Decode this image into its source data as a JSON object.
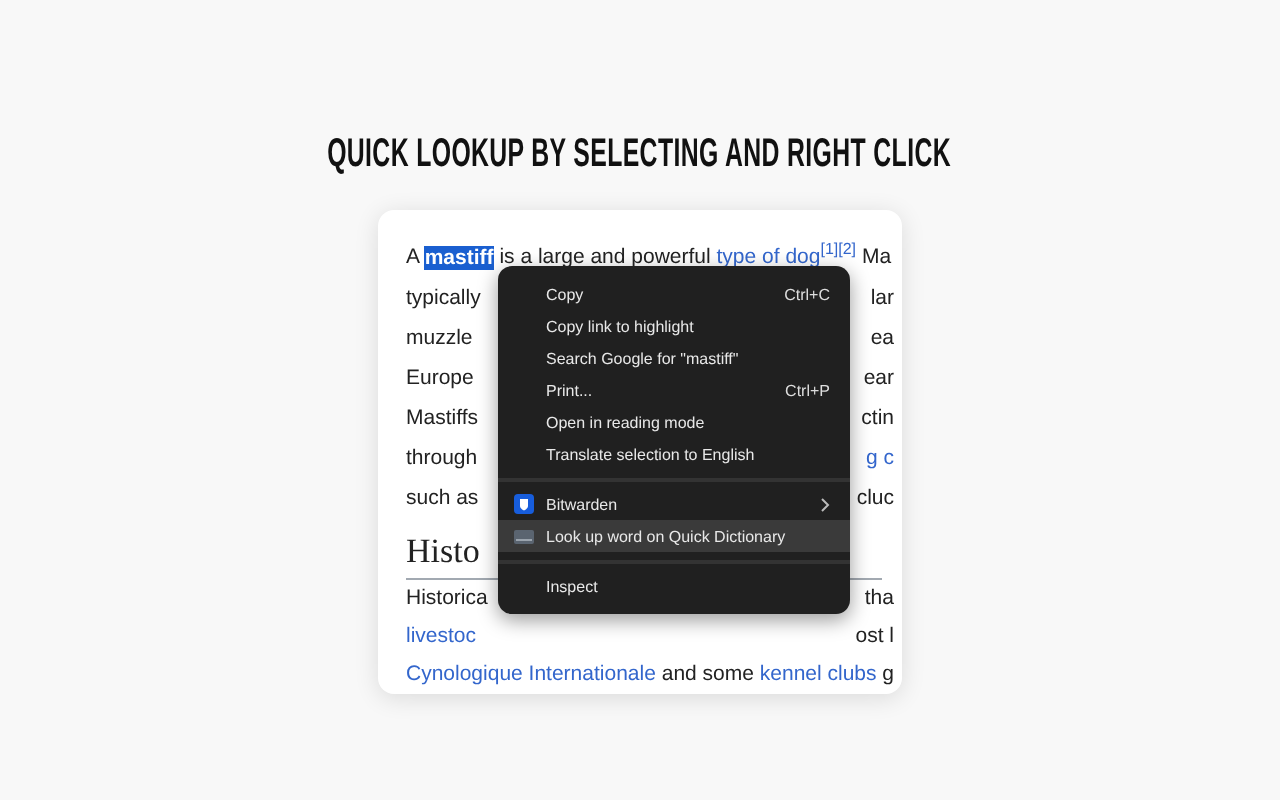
{
  "title": "QUICK LOOKUP BY SELECTING AND RIGHT CLICK",
  "article": {
    "first_line": [
      {
        "text": "A ",
        "kind": "plain"
      },
      {
        "text": "mastiff",
        "kind": "selected"
      },
      {
        "text": " is a large and powerful ",
        "kind": "plain"
      },
      {
        "text": "type of dog",
        "kind": "link"
      },
      {
        "text": "[1][2]",
        "kind": "sup"
      },
      {
        "text": " Ma",
        "kind": "plain"
      }
    ],
    "lines": [
      {
        "left": {
          "text": "typically",
          "kind": "plain"
        },
        "right": {
          "text": "lar",
          "kind": "plain"
        }
      },
      {
        "left": {
          "text": "muzzle",
          "kind": "plain"
        },
        "right": {
          "text": "ea",
          "kind": "plain"
        }
      },
      {
        "left": {
          "text": "Europe",
          "kind": "plain"
        },
        "right": {
          "text": "ear",
          "kind": "plain"
        }
      },
      {
        "left": {
          "text": "Mastiffs",
          "kind": "plain"
        },
        "right": {
          "text": "ctin",
          "kind": "plain"
        }
      },
      {
        "left": {
          "text": "through",
          "kind": "plain"
        },
        "right": {
          "text": "g c",
          "kind": "link"
        }
      },
      {
        "left": {
          "text": "such as",
          "kind": "plain"
        },
        "right": {
          "text": "cluc",
          "kind": "plain"
        }
      }
    ],
    "heading": "Histo",
    "lines_after": [
      {
        "left": {
          "text": "Historica",
          "kind": "plain"
        },
        "right": {
          "text": "tha",
          "kind": "plain"
        }
      },
      {
        "left": {
          "text": "livestoc",
          "kind": "link"
        },
        "right": {
          "text": "ost l",
          "kind": "plain"
        }
      }
    ],
    "last_line": [
      {
        "text": "Cynologique Internationale",
        "kind": "link"
      },
      {
        "text": " and some ",
        "kind": "plain"
      },
      {
        "text": "kennel clubs",
        "kind": "link"
      },
      {
        "text": " g",
        "kind": "plain"
      }
    ]
  },
  "context_menu": [
    {
      "kind": "item",
      "label": "Copy",
      "shortcut": "Ctrl+C",
      "selected": false
    },
    {
      "kind": "item",
      "label": "Copy link to highlight",
      "selected": false
    },
    {
      "kind": "item",
      "label": "Search Google for \"mastiff\"",
      "selected": false
    },
    {
      "kind": "item",
      "label": "Print...",
      "shortcut": "Ctrl+P",
      "selected": false
    },
    {
      "kind": "item",
      "label": "Open in reading mode",
      "selected": false
    },
    {
      "kind": "item",
      "label": "Translate selection to English",
      "selected": false
    },
    {
      "kind": "separator"
    },
    {
      "kind": "submenu",
      "label": "Bitwarden",
      "selected": false
    },
    {
      "kind": "extension",
      "label": "Look up word on Quick Dictionary",
      "selected": true
    },
    {
      "kind": "separator"
    },
    {
      "kind": "item",
      "label": "Inspect",
      "selected": false
    }
  ]
}
